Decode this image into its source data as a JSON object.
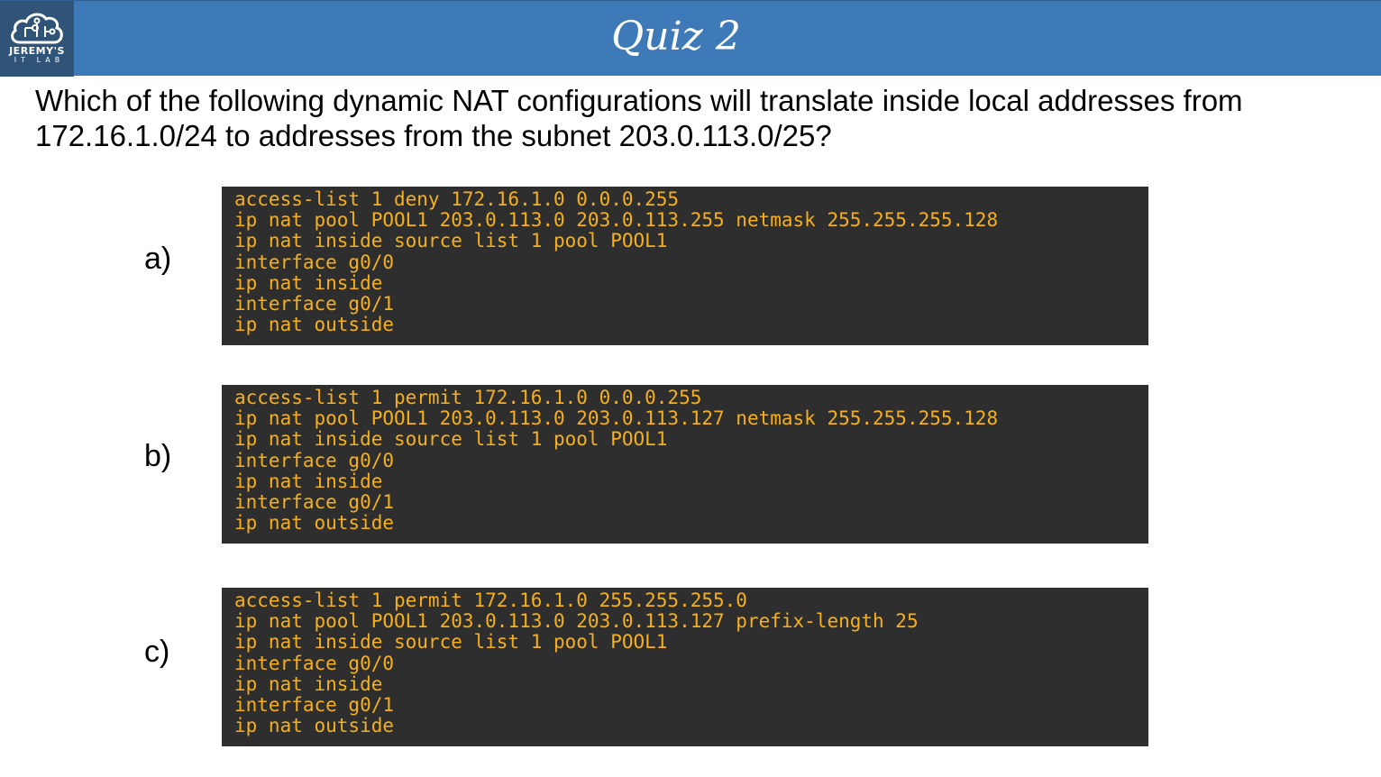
{
  "header": {
    "logo_name": "JEREMY'S",
    "logo_sub": "IT LAB",
    "title": "Quiz 2",
    "accent_color": "#3d7ab7"
  },
  "question": "Which of the following dynamic NAT configurations will translate inside local addresses from 172.16.1.0/24 to addresses from the subnet 203.0.113.0/25?",
  "options": [
    {
      "label": "a)",
      "lines": [
        "access-list 1 deny 172.16.1.0 0.0.0.255",
        "ip nat pool POOL1 203.0.113.0 203.0.113.255 netmask 255.255.255.128",
        "ip nat inside source list 1 pool POOL1",
        "interface g0/0",
        "ip nat inside",
        "interface g0/1",
        "ip nat outside"
      ]
    },
    {
      "label": "b)",
      "lines": [
        "access-list 1 permit 172.16.1.0 0.0.0.255",
        "ip nat pool POOL1 203.0.113.0 203.0.113.127 netmask 255.255.255.128",
        "ip nat inside source list 1 pool POOL1",
        "interface g0/0",
        "ip nat inside",
        "interface g0/1",
        "ip nat outside"
      ]
    },
    {
      "label": "c)",
      "lines": [
        "access-list 1 permit 172.16.1.0 255.255.255.0",
        "ip nat pool POOL1 203.0.113.0 203.0.113.127 prefix-length 25",
        "ip nat inside source list 1 pool POOL1",
        "interface g0/0",
        "ip nat inside",
        "interface g0/1",
        "ip nat outside"
      ]
    }
  ],
  "colors": {
    "code_background": "#2e2e2e",
    "code_text": "#f5b01b"
  },
  "icons": {
    "logo": "cloud-circuit-icon"
  }
}
